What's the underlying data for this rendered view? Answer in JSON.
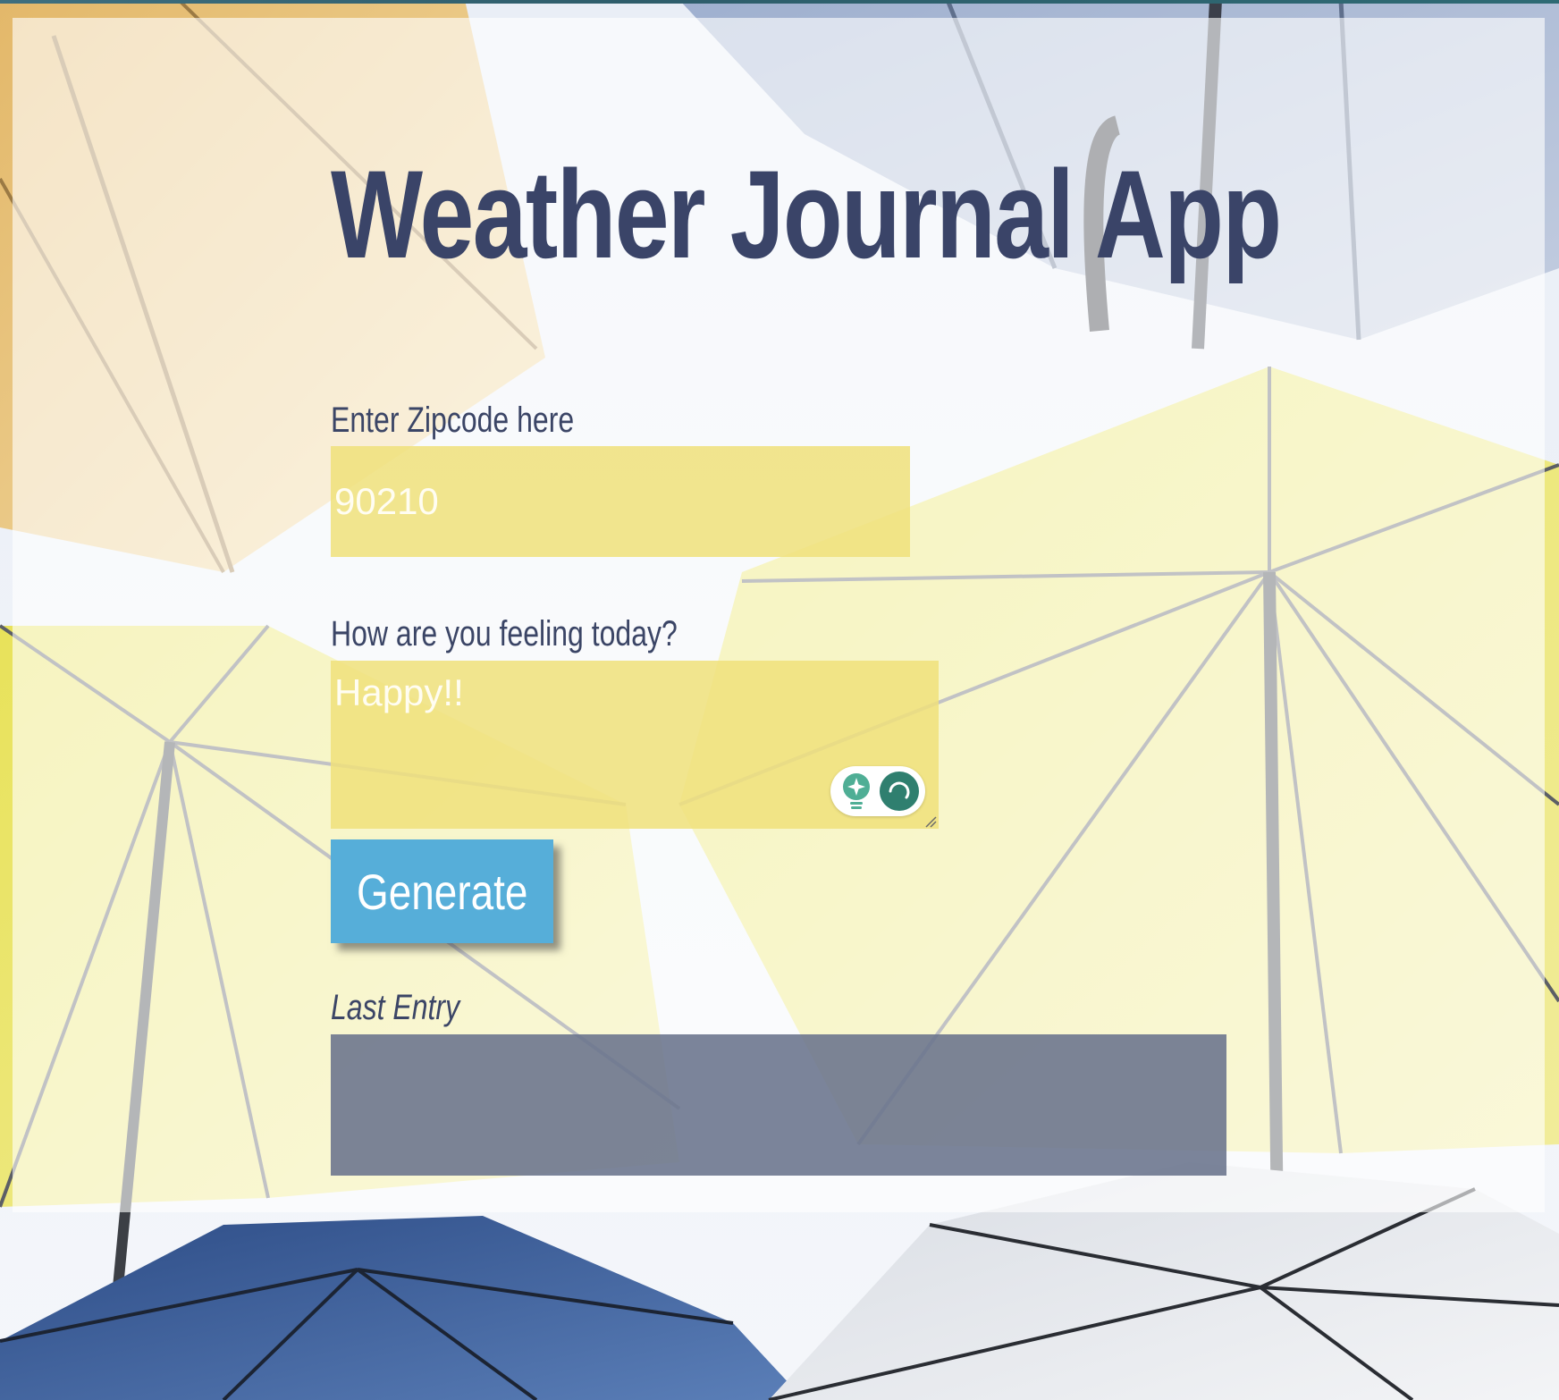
{
  "app": {
    "title": "Weather Journal App"
  },
  "zip": {
    "label": "Enter Zipcode here",
    "value": "90210"
  },
  "feelings": {
    "label": "How are you feeling today?",
    "value": "Happy!!"
  },
  "actions": {
    "generate_label": "Generate"
  },
  "entry": {
    "label": "Last Entry",
    "content": ""
  },
  "icons": {
    "assistant_bulb": "lightbulb-sparkle-icon",
    "assistant_status": "loading-spinner-icon",
    "resize": "resize-grip-icon"
  },
  "colors": {
    "title": "#3a4468",
    "label": "#3b4566",
    "input_fill": "#f0e07a",
    "button": "#56aed9",
    "entry_box": "#69738c",
    "assistant_accent": "#2f7f6f"
  }
}
